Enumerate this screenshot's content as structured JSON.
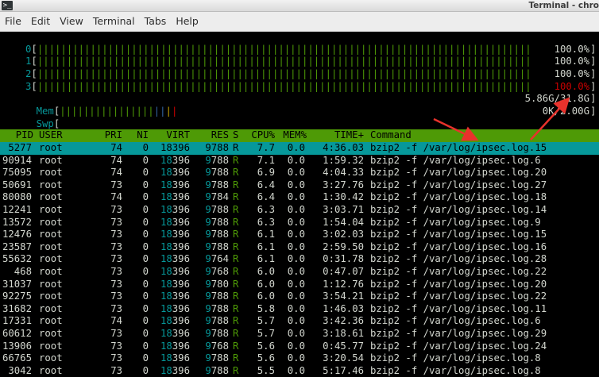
{
  "window": {
    "title": "Terminal - chro",
    "app_icon": ">_"
  },
  "menu": [
    "File",
    "Edit",
    "View",
    "Terminal",
    "Tabs",
    "Help"
  ],
  "meters": {
    "cpus": [
      {
        "label": "0",
        "value": "100.0%",
        "usage": 1.0
      },
      {
        "label": "1",
        "value": "100.0%",
        "usage": 1.0
      },
      {
        "label": "2",
        "value": "100.0%",
        "usage": 1.0
      },
      {
        "label": "3",
        "value": "100.0%",
        "usage": 1.0
      }
    ],
    "mem": {
      "label": "Mem",
      "value": "5.86G/31.8G"
    },
    "swap": {
      "label": "Swp",
      "value": "0K/2.00G"
    }
  },
  "table": {
    "columns": [
      "PID",
      "USER",
      "PRI",
      "NI",
      "VIRT",
      "RES",
      "S",
      "CPU%",
      "MEM%",
      "TIME+",
      "Command"
    ],
    "rows": [
      {
        "pid": "5277",
        "user": "root",
        "pri": "74",
        "ni": "0",
        "virt": "18396",
        "res": "9788",
        "s": "R",
        "cpu": "7.7",
        "mem": "0.0",
        "time": "4:36.03",
        "cmd": "bzip2 -f /var/log/ipsec.log.15",
        "selected": true
      },
      {
        "pid": "90914",
        "user": "root",
        "pri": "74",
        "ni": "0",
        "virt": "18396",
        "res": "9788",
        "s": "R",
        "cpu": "7.1",
        "mem": "0.0",
        "time": "1:59.32",
        "cmd": "bzip2 -f /var/log/ipsec.log.6"
      },
      {
        "pid": "75095",
        "user": "root",
        "pri": "74",
        "ni": "0",
        "virt": "18396",
        "res": "9788",
        "s": "R",
        "cpu": "6.9",
        "mem": "0.0",
        "time": "4:04.33",
        "cmd": "bzip2 -f /var/log/ipsec.log.20"
      },
      {
        "pid": "50691",
        "user": "root",
        "pri": "73",
        "ni": "0",
        "virt": "18396",
        "res": "9788",
        "s": "R",
        "cpu": "6.4",
        "mem": "0.0",
        "time": "3:27.76",
        "cmd": "bzip2 -f /var/log/ipsec.log.27"
      },
      {
        "pid": "80080",
        "user": "root",
        "pri": "74",
        "ni": "0",
        "virt": "18396",
        "res": "9784",
        "s": "R",
        "cpu": "6.4",
        "mem": "0.0",
        "time": "1:30.42",
        "cmd": "bzip2 -f /var/log/ipsec.log.18"
      },
      {
        "pid": "12241",
        "user": "root",
        "pri": "73",
        "ni": "0",
        "virt": "18396",
        "res": "9788",
        "s": "R",
        "cpu": "6.3",
        "mem": "0.0",
        "time": "3:03.71",
        "cmd": "bzip2 -f /var/log/ipsec.log.14"
      },
      {
        "pid": "13572",
        "user": "root",
        "pri": "73",
        "ni": "0",
        "virt": "18396",
        "res": "9788",
        "s": "R",
        "cpu": "6.3",
        "mem": "0.0",
        "time": "1:54.04",
        "cmd": "bzip2 -f /var/log/ipsec.log.9"
      },
      {
        "pid": "12476",
        "user": "root",
        "pri": "73",
        "ni": "0",
        "virt": "18396",
        "res": "9788",
        "s": "R",
        "cpu": "6.1",
        "mem": "0.0",
        "time": "3:02.03",
        "cmd": "bzip2 -f /var/log/ipsec.log.15"
      },
      {
        "pid": "23587",
        "user": "root",
        "pri": "73",
        "ni": "0",
        "virt": "18396",
        "res": "9788",
        "s": "R",
        "cpu": "6.1",
        "mem": "0.0",
        "time": "2:59.50",
        "cmd": "bzip2 -f /var/log/ipsec.log.16"
      },
      {
        "pid": "55632",
        "user": "root",
        "pri": "73",
        "ni": "0",
        "virt": "18396",
        "res": "9764",
        "s": "R",
        "cpu": "6.1",
        "mem": "0.0",
        "time": "0:31.78",
        "cmd": "bzip2 -f /var/log/ipsec.log.28"
      },
      {
        "pid": "468",
        "user": "root",
        "pri": "73",
        "ni": "0",
        "virt": "18396",
        "res": "9768",
        "s": "R",
        "cpu": "6.0",
        "mem": "0.0",
        "time": "0:47.07",
        "cmd": "bzip2 -f /var/log/ipsec.log.22"
      },
      {
        "pid": "31037",
        "user": "root",
        "pri": "73",
        "ni": "0",
        "virt": "18396",
        "res": "9780",
        "s": "R",
        "cpu": "6.0",
        "mem": "0.0",
        "time": "1:12.76",
        "cmd": "bzip2 -f /var/log/ipsec.log.20"
      },
      {
        "pid": "92275",
        "user": "root",
        "pri": "73",
        "ni": "0",
        "virt": "18396",
        "res": "9788",
        "s": "R",
        "cpu": "6.0",
        "mem": "0.0",
        "time": "3:54.21",
        "cmd": "bzip2 -f /var/log/ipsec.log.22"
      },
      {
        "pid": "31682",
        "user": "root",
        "pri": "73",
        "ni": "0",
        "virt": "18396",
        "res": "9788",
        "s": "R",
        "cpu": "5.8",
        "mem": "0.0",
        "time": "1:46.03",
        "cmd": "bzip2 -f /var/log/ipsec.log.11"
      },
      {
        "pid": "17331",
        "user": "root",
        "pri": "74",
        "ni": "0",
        "virt": "18396",
        "res": "9788",
        "s": "R",
        "cpu": "5.7",
        "mem": "0.0",
        "time": "3:42.36",
        "cmd": "bzip2 -f /var/log/ipsec.log.6"
      },
      {
        "pid": "60612",
        "user": "root",
        "pri": "73",
        "ni": "0",
        "virt": "18396",
        "res": "9788",
        "s": "R",
        "cpu": "5.7",
        "mem": "0.0",
        "time": "3:18.61",
        "cmd": "bzip2 -f /var/log/ipsec.log.29"
      },
      {
        "pid": "13906",
        "user": "root",
        "pri": "73",
        "ni": "0",
        "virt": "18396",
        "res": "9768",
        "s": "R",
        "cpu": "5.6",
        "mem": "0.0",
        "time": "0:45.77",
        "cmd": "bzip2 -f /var/log/ipsec.log.24"
      },
      {
        "pid": "66765",
        "user": "root",
        "pri": "73",
        "ni": "0",
        "virt": "18396",
        "res": "9788",
        "s": "R",
        "cpu": "5.6",
        "mem": "0.0",
        "time": "3:20.54",
        "cmd": "bzip2 -f /var/log/ipsec.log.8"
      },
      {
        "pid": "3042",
        "user": "root",
        "pri": "73",
        "ni": "0",
        "virt": "18396",
        "res": "9788",
        "s": "R",
        "cpu": "5.5",
        "mem": "0.0",
        "time": "5:17.46",
        "cmd": "bzip2 -f /var/log/ipsec.log.8"
      }
    ]
  },
  "colors": {
    "header_bg": "#4e9a06",
    "selected_row_bg": "#06989a",
    "annotation_arrow": "#e8322c",
    "meter_bar": "#4e9a06",
    "meter_high": "#cc0000"
  }
}
